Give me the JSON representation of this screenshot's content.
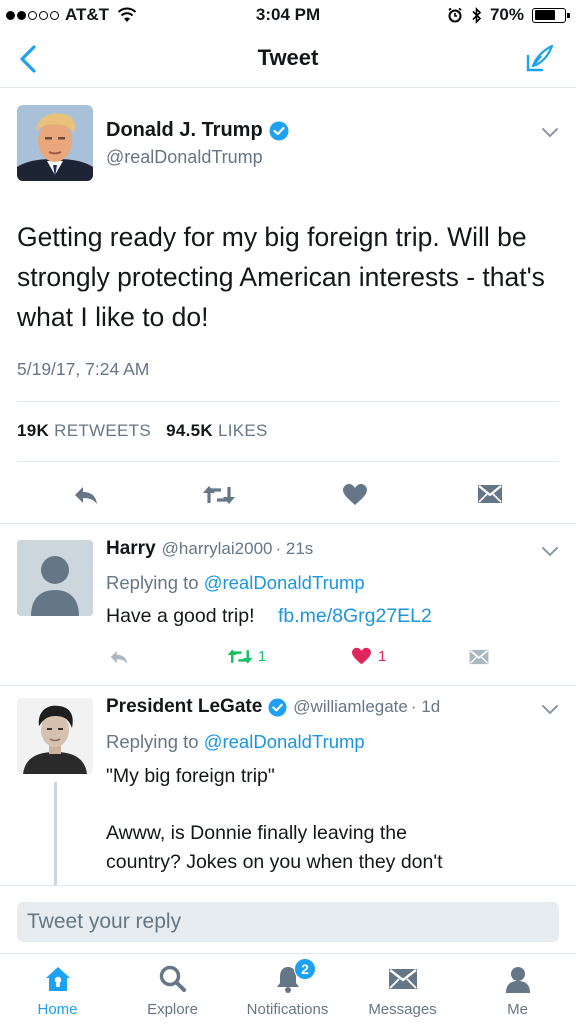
{
  "status_bar": {
    "carrier": "AT&T",
    "time": "3:04 PM",
    "battery": "70%",
    "battery_level": 0.7
  },
  "nav": {
    "title": "Tweet"
  },
  "tweet": {
    "author_name": "Donald J. Trump",
    "author_handle": "@realDonaldTrump",
    "text": "Getting ready for my big foreign trip. Will be strongly protecting American interests - that's what I like to do!",
    "date": "5/19/17, 7:24 AM",
    "retweets_count": "19K",
    "retweets_label": "RETWEETS",
    "likes_count": "94.5K",
    "likes_label": "LIKES"
  },
  "replies": [
    {
      "name": "Harry",
      "handle": "@harrylai2000",
      "time": "· 21s",
      "replying_prefix": "Replying to",
      "replying_to": "@realDonaldTrump",
      "text": "Have a good trip!",
      "link": "fb.me/8Grg27EL2",
      "retweet_count": "1",
      "like_count": "1"
    },
    {
      "name": "President LeGate",
      "handle": "@williamlegate",
      "time": "· 1d",
      "replying_prefix": "Replying to",
      "replying_to": "@realDonaldTrump",
      "text_line1": "\"My big foreign trip\"",
      "text_line2": "Awww, is Donnie finally leaving the",
      "text_line3": "country? Jokes on you when they don't"
    }
  ],
  "reply_box": {
    "placeholder": "Tweet your reply"
  },
  "tabs": [
    {
      "label": "Home",
      "icon": "home-icon",
      "active": true
    },
    {
      "label": "Explore",
      "icon": "search-icon"
    },
    {
      "label": "Notifications",
      "icon": "bell-icon",
      "badge": "2"
    },
    {
      "label": "Messages",
      "icon": "envelope-icon"
    },
    {
      "label": "Me",
      "icon": "person-icon"
    }
  ],
  "colors": {
    "accent": "#1da1f2",
    "link": "#1b95e0",
    "retweet_active": "#17bf63",
    "like_active": "#e0245e",
    "secondary_text": "#657786"
  }
}
